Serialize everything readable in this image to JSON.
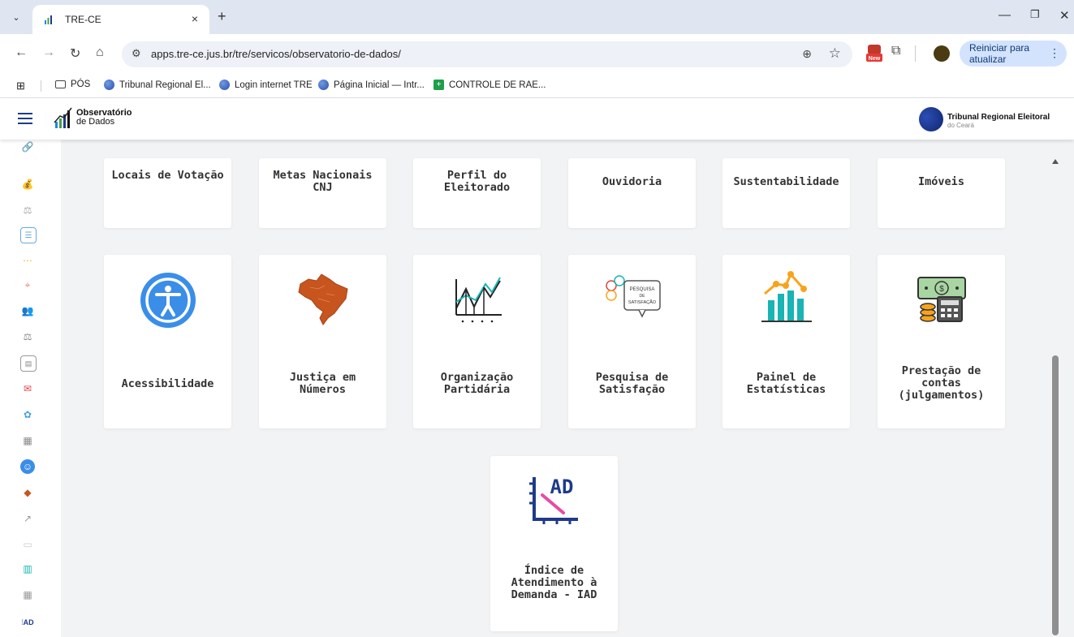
{
  "browser": {
    "tab_title": "TRE-CE",
    "tab_close": "×",
    "new_tab": "+",
    "url": "apps.tre-ce.jus.br/tre/servicos/observatorio-de-dados/",
    "restart_label": "Reiniciar para atualizar",
    "new_badge": "New",
    "bookmarks": [
      {
        "label": "PÓS",
        "icon": "folder-icon"
      },
      {
        "label": "Tribunal Regional El...",
        "icon": "globe-icon"
      },
      {
        "label": "Login internet TRE",
        "icon": "globe-icon"
      },
      {
        "label": "Página Inicial — Intr...",
        "icon": "globe-icon"
      },
      {
        "label": "CONTROLE DE RAE...",
        "icon": "green-plus-icon"
      }
    ]
  },
  "header": {
    "logo_title": "Observatório",
    "logo_subtitle": "de Dados",
    "org_name": "Tribunal Regional Eleitoral",
    "org_sub": "do Ceará"
  },
  "cards_top": [
    {
      "label": "Locais de Votação"
    },
    {
      "label": "Metas Nacionais CNJ"
    },
    {
      "label": "Perfil do Eleitorado"
    },
    {
      "label": "Ouvidoria"
    },
    {
      "label": "Sustentabilidade"
    },
    {
      "label": "Imóveis"
    }
  ],
  "cards_middle": [
    {
      "label": "Acessibilidade",
      "icon": "accessibility-icon"
    },
    {
      "label": "Justiça em Números",
      "icon": "brazil-map-icon"
    },
    {
      "label": "Organização Partidária",
      "icon": "line-chart-icon"
    },
    {
      "label": "Pesquisa de Satisfação",
      "icon": "survey-icon",
      "icon_text_1": "PESQUISA",
      "icon_text_2": "DE",
      "icon_text_3": "SATISFAÇÃO"
    },
    {
      "label": "Painel de Estatísticas",
      "icon": "bar-chart-icon"
    },
    {
      "label": "Prestação de contas (julgamentos)",
      "icon": "money-calculator-icon"
    }
  ],
  "card_bottom": {
    "label": "Índice de Atendimento à Demanda - IAD",
    "icon": "iad-chart-icon",
    "icon_text": "AD",
    "rail_text": "AD"
  },
  "colors": {
    "accent": "#1e3a8a",
    "accessibility": "#3b8ee8",
    "map": "#c8551e",
    "chart_teal": "#19b4b4",
    "chart_orange": "#f7a41d"
  }
}
